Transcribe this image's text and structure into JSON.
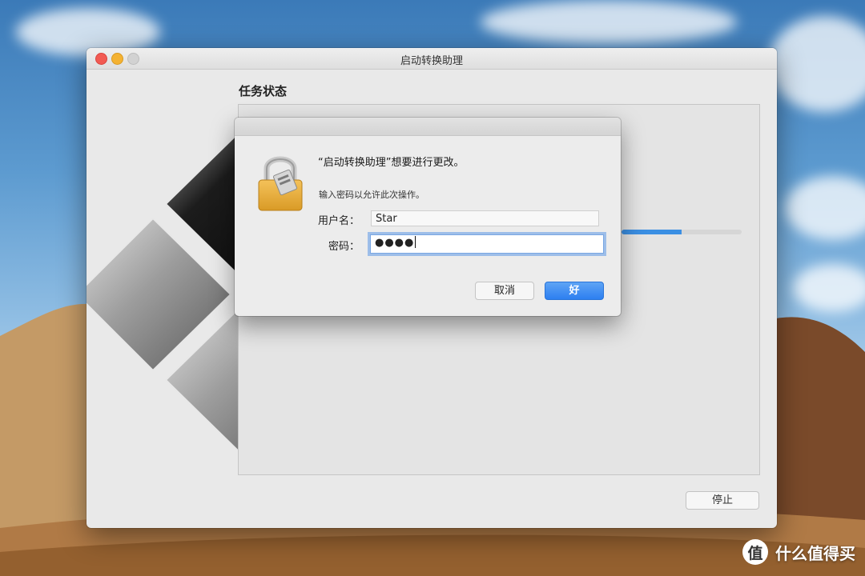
{
  "window": {
    "title": "启动转换助理",
    "section_title": "任务状态",
    "progress": 0.5,
    "stop_label": "停止"
  },
  "dialog": {
    "heading": "“启动转换助理”想要进行更改。",
    "subtitle": "输入密码以允许此次操作。",
    "username_label": "用户名：",
    "username_value": "Star",
    "password_label": "密码：",
    "password_masked": "●●●●",
    "cancel_label": "取消",
    "ok_label": "好"
  },
  "watermark": {
    "logo_char": "值",
    "text": "什么值得买"
  },
  "colors": {
    "accent": "#2d7ff0",
    "progress": "#3b8fe3",
    "close": "#f25a52",
    "minimize": "#f4b232"
  },
  "icons": [
    "lock-icon",
    "bootcamp-logo",
    "close-icon",
    "minimize-icon",
    "zoom-icon"
  ]
}
